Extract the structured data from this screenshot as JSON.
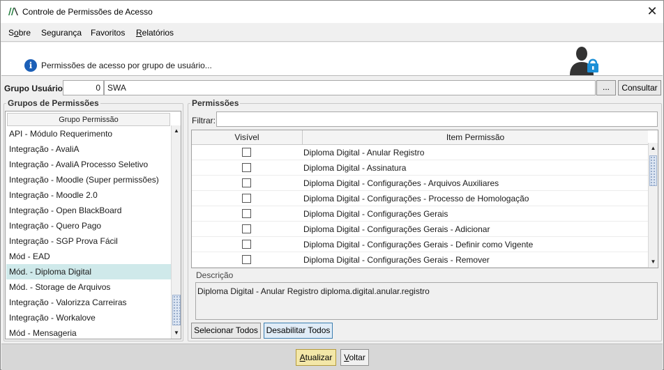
{
  "window": {
    "title": "Controle de Permissões de Acesso",
    "close_symbol": "✕"
  },
  "menu": {
    "items": [
      {
        "label": "Sobre",
        "accel_index": 1
      },
      {
        "label": "Segurança"
      },
      {
        "label": "Favoritos"
      },
      {
        "label": "Relatórios",
        "accel_index": 0
      }
    ]
  },
  "header": {
    "info_text": "Permissões de acesso por grupo de usuário...",
    "info_glyph": "i"
  },
  "user_group": {
    "label": "Grupo Usuário:",
    "id_value": "0",
    "name_value": "SWA",
    "browse_label": "...",
    "consult_label": "Consultar"
  },
  "left_panel": {
    "title": "Grupos de Permissões",
    "column_header": "Grupo Permissão",
    "rows": [
      "API - Módulo Requerimento",
      "Integração - AvaliA",
      "Integração - AvaliA Processo Seletivo",
      "Integração - Moodle (Super permissões)",
      "Integração - Moodle 2.0",
      "Integração - Open BlackBoard",
      "Integração - Quero Pago",
      "Integração - SGP Prova Fácil",
      "Mód - EAD",
      "Mód. - Diploma Digital",
      "Mód. - Storage de Arquivos",
      "Integração - Valorizza Carreiras",
      "Integração - Workalove",
      "Mód - Mensageria"
    ],
    "selected_index": 9,
    "scroll_up": "▲",
    "scroll_down": "▼"
  },
  "right_panel": {
    "title": "Permissões",
    "filter_label": "Filtrar:",
    "filter_value": "",
    "columns": {
      "visible": "Visível",
      "item": "Item Permissão"
    },
    "rows": [
      {
        "visible": false,
        "item": "Diploma Digital - Anular Registro"
      },
      {
        "visible": false,
        "item": "Diploma Digital - Assinatura"
      },
      {
        "visible": false,
        "item": "Diploma Digital - Configurações - Arquivos Auxiliares"
      },
      {
        "visible": false,
        "item": "Diploma Digital - Configurações - Processo de Homologação"
      },
      {
        "visible": false,
        "item": "Diploma Digital - Configurações Gerais"
      },
      {
        "visible": false,
        "item": "Diploma Digital - Configurações Gerais - Adicionar"
      },
      {
        "visible": false,
        "item": "Diploma Digital - Configurações Gerais - Definir como Vigente"
      },
      {
        "visible": false,
        "item": "Diploma Digital - Configurações Gerais - Remover"
      }
    ],
    "scroll_up": "▲",
    "scroll_down": "▼",
    "description_title": "Descrição",
    "description_text": "Diploma Digital - Anular Registro diploma.digital.anular.registro",
    "select_all_label": "Selecionar Todos",
    "disable_all_label": "Desabilitar Todos"
  },
  "footer": {
    "update_label": "Atualizar",
    "back_label": "Voltar"
  },
  "colors": {
    "selected_row": "#cfe9ea",
    "update_button": "#f3e7a8",
    "info_icon": "#1b5fb7",
    "lock": "#1c8fd6"
  }
}
